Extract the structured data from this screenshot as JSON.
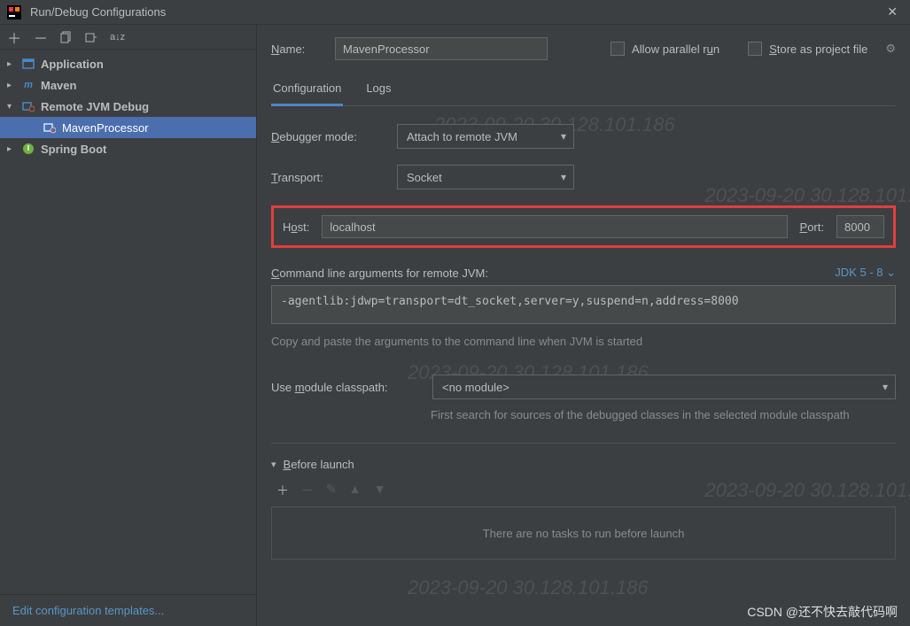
{
  "title": "Run/Debug Configurations",
  "watermark": "2023-09-20 30.128.101.186",
  "csdn": "CSDN @还不快去敲代码啊",
  "sidebar": {
    "items": [
      {
        "label": "Application",
        "expandable": true,
        "open": false,
        "icon": "app",
        "child": null
      },
      {
        "label": "Maven",
        "expandable": true,
        "open": false,
        "icon": "maven",
        "child": null
      },
      {
        "label": "Remote JVM Debug",
        "expandable": true,
        "open": true,
        "icon": "remote",
        "child": "MavenProcessor"
      },
      {
        "label": "Spring Boot",
        "expandable": true,
        "open": false,
        "icon": "spring",
        "child": null
      }
    ],
    "footer_link": "Edit configuration templates..."
  },
  "form": {
    "name_label": "Name:",
    "name_value": "MavenProcessor",
    "allow_parallel": "Allow parallel run",
    "store_as_file": "Store as project file",
    "tabs": [
      "Configuration",
      "Logs"
    ],
    "active_tab": 0,
    "debugger_mode_label": "Debugger mode:",
    "debugger_mode_value": "Attach to remote JVM",
    "transport_label": "Transport:",
    "transport_value": "Socket",
    "host_label": "Host:",
    "host_value": "localhost",
    "port_label": "Port:",
    "port_value": "8000",
    "cmdline_label": "Command line arguments for remote JVM:",
    "jdk_label": "JDK 5 - 8",
    "cmdline_value": "-agentlib:jdwp=transport=dt_socket,server=y,suspend=n,address=8000",
    "cmdline_hint": "Copy and paste the arguments to the command line when JVM is started",
    "module_label": "Use module classpath:",
    "module_value": "<no module>",
    "module_hint": "First search for sources of the debugged classes in the selected module classpath",
    "before_launch_label": "Before launch",
    "no_tasks": "There are no tasks to run before launch"
  }
}
